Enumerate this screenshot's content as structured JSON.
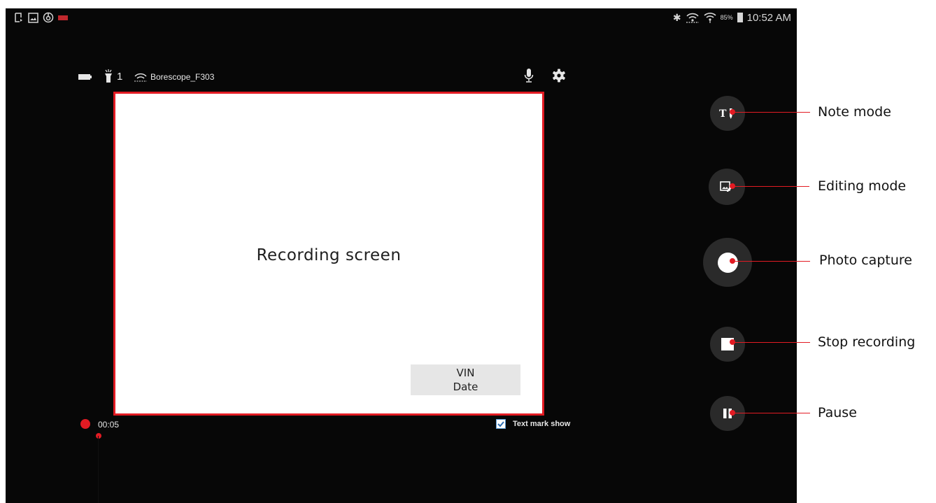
{
  "status_bar": {
    "notification_icons": [
      "screen-record-icon",
      "image-icon",
      "power-icon",
      "app-badge-icon"
    ],
    "battery_percent": "85%",
    "time": "10:52 AM"
  },
  "camera_bar": {
    "light_level": "1",
    "device_name": "Borescope_F303"
  },
  "viewport": {
    "label": "Recording screen",
    "overlay_vin": "VIN",
    "overlay_date": "Date"
  },
  "recording": {
    "elapsed": "00:05",
    "text_mark_label": "Text mark show",
    "text_mark_checked": true
  },
  "controls": [
    {
      "id": "note",
      "icon": "note-mode-icon",
      "callout": "Note mode"
    },
    {
      "id": "edit",
      "icon": "editing-mode-icon",
      "callout": "Editing mode"
    },
    {
      "id": "capture",
      "icon": "photo-capture-icon",
      "callout": "Photo capture"
    },
    {
      "id": "stop",
      "icon": "stop-icon",
      "callout": "Stop recording"
    },
    {
      "id": "pause",
      "icon": "pause-icon",
      "callout": "Pause"
    }
  ],
  "colors": {
    "accent": "#e21b23",
    "background": "#070707",
    "button": "#2a2a2a"
  }
}
